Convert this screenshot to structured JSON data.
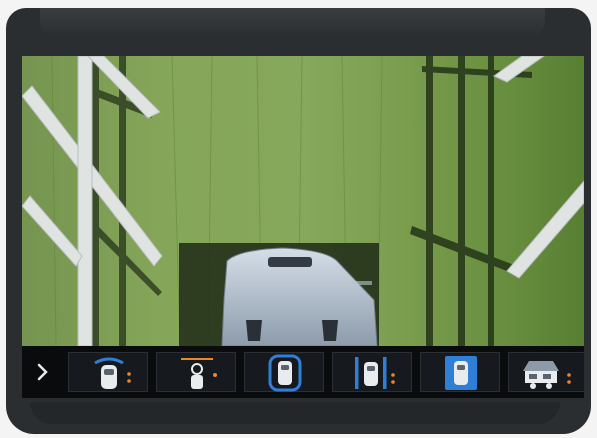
{
  "app": {
    "device": "infotainment-camera-display",
    "active_view_index": 4
  },
  "camera": {
    "ground": "grass",
    "subject": "vehicle-top-down"
  },
  "toolbar": {
    "expand_icon": "chevron-right-icon",
    "views": [
      {
        "icon": "front-top-view-icon"
      },
      {
        "icon": "front-bird-view-icon"
      },
      {
        "icon": "surround-view-icon"
      },
      {
        "icon": "side-view-icon"
      },
      {
        "icon": "top-down-view-icon"
      },
      {
        "icon": "trailer-view-icon"
      }
    ]
  },
  "colors": {
    "accent": "#2f7fd6",
    "indicator": "#e8892a",
    "toolbar_bg": "#0a0b0d",
    "bezel": "#2b2e31"
  }
}
